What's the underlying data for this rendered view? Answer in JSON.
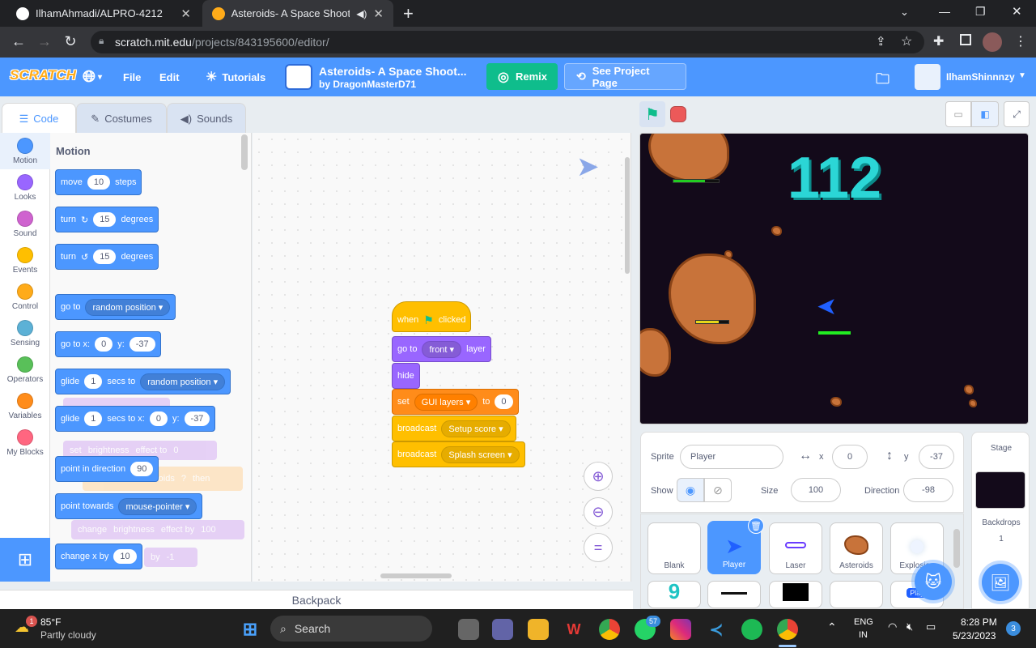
{
  "browser": {
    "tabs": [
      {
        "title": "IlhamAhmadi/ALPRO-4212"
      },
      {
        "title": "Asteroids- A Space Shooter"
      }
    ],
    "url_host": "scratch.mit.edu",
    "url_path": "/projects/843195600/editor/"
  },
  "menubar": {
    "logo": "SCRATCH",
    "file": "File",
    "edit": "Edit",
    "tutorials": "Tutorials",
    "project_title": "Asteroids- A Space Shoot...",
    "author": "by DragonMasterD71",
    "remix": "Remix",
    "see_project": "See Project Page",
    "username": "IlhamShinnnzy"
  },
  "editor_tabs": {
    "code": "Code",
    "costumes": "Costumes",
    "sounds": "Sounds"
  },
  "categories": [
    {
      "label": "Motion",
      "color": "#4c97ff"
    },
    {
      "label": "Looks",
      "color": "#9966ff"
    },
    {
      "label": "Sound",
      "color": "#cf63cf"
    },
    {
      "label": "Events",
      "color": "#ffbf00"
    },
    {
      "label": "Control",
      "color": "#ffab19"
    },
    {
      "label": "Sensing",
      "color": "#5cb1d6"
    },
    {
      "label": "Operators",
      "color": "#59c059"
    },
    {
      "label": "Variables",
      "color": "#ff8c1a"
    },
    {
      "label": "My Blocks",
      "color": "#ff6680"
    }
  ],
  "palette": {
    "title": "Motion",
    "move": {
      "a": "move",
      "v": "10",
      "b": "steps"
    },
    "turn_cw": {
      "a": "turn",
      "v": "15",
      "b": "degrees"
    },
    "turn_ccw": {
      "a": "turn",
      "v": "15",
      "b": "degrees"
    },
    "goto": {
      "a": "go to",
      "d": "random position"
    },
    "gotoxy": {
      "a": "go to x:",
      "x": "0",
      "b": "y:",
      "y": "-37"
    },
    "glide": {
      "a": "glide",
      "v": "1",
      "b": "secs to",
      "d": "random position"
    },
    "glidexy": {
      "a": "glide",
      "v": "1",
      "b": "secs to x:",
      "x": "0",
      "c": "y:",
      "y": "-37"
    },
    "ghost1": {
      "a": "set",
      "d": "brightness",
      "b": "effect to",
      "v": "0"
    },
    "point_dir": {
      "a": "point in direction",
      "v": "90"
    },
    "ghost2": {
      "d": "Asteroids",
      "v": "?",
      "b": "then"
    },
    "point_towards": {
      "a": "point towards",
      "d": "mouse-pointer"
    },
    "ghost3": {
      "a": "change",
      "d": "brightness",
      "b": "effect by",
      "v": "100"
    },
    "changex": {
      "a": "change x by",
      "v": "10",
      "b": "by",
      "w": "-1"
    }
  },
  "script": {
    "hat": {
      "a": "when",
      "b": "clicked"
    },
    "goto_layer": {
      "a": "go to",
      "d": "front",
      "b": "layer"
    },
    "hide": "hide",
    "set": {
      "a": "set",
      "d": "GUI layers",
      "b": "to",
      "v": "0"
    },
    "bc1": {
      "a": "broadcast",
      "d": "Setup score"
    },
    "bc2": {
      "a": "broadcast",
      "d": "Splash screen"
    }
  },
  "backpack": "Backpack",
  "stage": {
    "score": "112"
  },
  "sprite_info": {
    "sprite_label": "Sprite",
    "sprite_name": "Player",
    "x_label": "x",
    "x": "0",
    "y_label": "y",
    "y": "-37",
    "show_label": "Show",
    "size_label": "Size",
    "size": "100",
    "direction_label": "Direction",
    "direction": "-98"
  },
  "sprites": [
    {
      "name": "Blank"
    },
    {
      "name": "Player"
    },
    {
      "name": "Laser"
    },
    {
      "name": "Asteroids"
    },
    {
      "name": "Explosion"
    }
  ],
  "stage_panel": {
    "title": "Stage",
    "backdrops_label": "Backdrops",
    "backdrops_count": "1"
  },
  "taskbar": {
    "temp": "85°F",
    "weather": "Partly cloudy",
    "weather_badge": "1",
    "search": "Search",
    "whatsapp_badge": "57",
    "lang1": "ENG",
    "lang2": "IN",
    "time": "8:28 PM",
    "date": "5/23/2023",
    "notif": "3"
  }
}
